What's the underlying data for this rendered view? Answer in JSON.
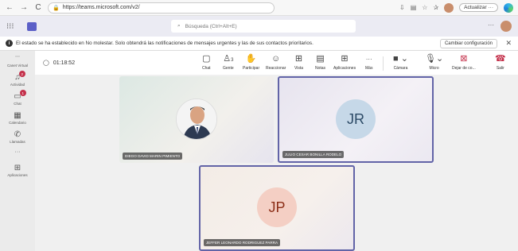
{
  "browser": {
    "back": "←",
    "forward": "→",
    "reload": "C",
    "url": "https://teams.microsoft.com/v2/",
    "update_label": "Actualizar",
    "update_more": "···"
  },
  "teams": {
    "search_placeholder": "Búsqueda (Ctrl+Alt+E)",
    "more": "···"
  },
  "banner": {
    "text": "El estado se ha establecido en No molestar. Solo obtendrá las notificaciones de mensajes urgentes y las de sus contactos prioritarios.",
    "button": "Cambiar configuración",
    "close": "✕"
  },
  "rail": {
    "items": [
      {
        "label": "Canet Virtual",
        "icon": "…"
      },
      {
        "label": "Actividad",
        "icon": "🔔",
        "badge": "2"
      },
      {
        "label": "Chat",
        "icon": "💬",
        "badge": "1"
      },
      {
        "label": "Calendario",
        "icon": "▦"
      },
      {
        "label": "Llamadas",
        "icon": "✆"
      },
      {
        "label": "···",
        "icon": ""
      },
      {
        "label": "Aplicaciones",
        "icon": "⊞"
      }
    ]
  },
  "meeting": {
    "timer": "01:18:52",
    "tools": [
      {
        "label": "Chat",
        "icon": "💬"
      },
      {
        "label": "Gente",
        "icon": "👥"
      },
      {
        "label": "Participar",
        "icon": "✋"
      },
      {
        "label": "Reaccionar",
        "icon": "☺"
      },
      {
        "label": "Vista",
        "icon": "⊞"
      },
      {
        "label": "Notas",
        "icon": "▤"
      },
      {
        "label": "Aplicaciones",
        "icon": "⊞"
      },
      {
        "label": "Más",
        "icon": "···"
      },
      {
        "label": "Cámara",
        "icon": "▶"
      },
      {
        "label": "Micro",
        "icon": "🎙"
      },
      {
        "label": "Dejar de co...",
        "icon": "⊠"
      },
      {
        "label": "Salir",
        "icon": "☎"
      }
    ],
    "people_count": "3"
  },
  "participants": [
    {
      "name": "DIEGO DAVID MARIN PIMIENTO",
      "initials": ""
    },
    {
      "name": "JULIO CESAR BONILLA RODELO",
      "initials": "JR"
    },
    {
      "name": "JEFFER LEONARDO RODRIGUEZ PARRA",
      "initials": "JP"
    }
  ],
  "colors": {
    "accent": "#6264a7",
    "leave": "#c4314b",
    "badge": "#c4314b"
  }
}
